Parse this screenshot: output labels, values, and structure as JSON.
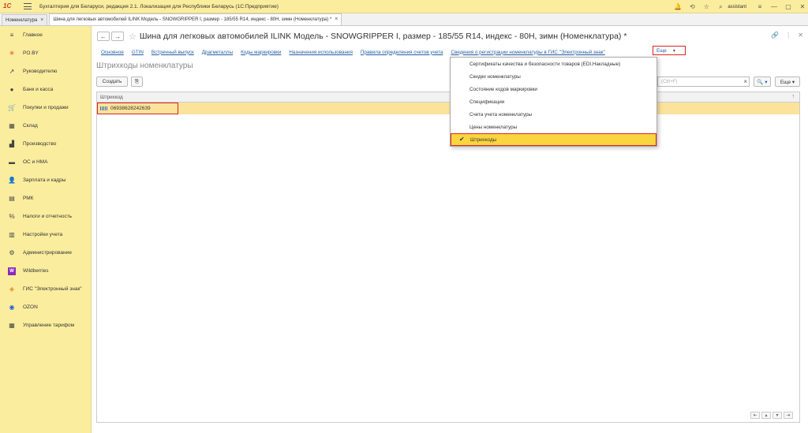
{
  "app": {
    "logo": "1С",
    "title": "Бухгалтерия для Беларуси, редакция 2.1. Локализация для Республики Беларусь   (1С:Предприятие)",
    "user": "assistant"
  },
  "tabs": [
    {
      "label": "Номенклатура",
      "close": "×"
    },
    {
      "label": "Шина для легковых автомобилей ILINK  Модель - SNOWGRIPPER I, размер - 185/55 R14, индекс - 80H, зимн (Номенклатура) *",
      "close": "×"
    }
  ],
  "sidebar": {
    "items": [
      {
        "label": "Главное",
        "icon": "≡"
      },
      {
        "label": "PO.BY",
        "icon": "✳"
      },
      {
        "label": "Руководителю",
        "icon": "↗"
      },
      {
        "label": "Банк и касса",
        "icon": "●"
      },
      {
        "label": "Покупки и продажи",
        "icon": "🛒"
      },
      {
        "label": "Склад",
        "icon": "▦"
      },
      {
        "label": "Производство",
        "icon": "▟"
      },
      {
        "label": "ОС и НМА",
        "icon": "▬"
      },
      {
        "label": "Зарплата и кадры",
        "icon": "👤"
      },
      {
        "label": "РМК",
        "icon": "▤"
      },
      {
        "label": "Налоги и отчетность",
        "icon": "%"
      },
      {
        "label": "Настройки учета",
        "icon": "▥"
      },
      {
        "label": "Администрирование",
        "icon": "⚙"
      },
      {
        "label": "Wildberries",
        "icon": "W"
      },
      {
        "label": "ГИС \"Электронный знак\"",
        "icon": "◈"
      },
      {
        "label": "OZON",
        "icon": "◉"
      },
      {
        "label": "Управление тарифом",
        "icon": "▦"
      }
    ]
  },
  "form": {
    "title": "Шина для легковых автомобилей ILINK  Модель - SNOWGRIPPER I, размер - 185/55 R14, индекс - 80H, зимн (Номенклатура) *",
    "back": "←",
    "forward": "→",
    "star": "☆",
    "links": [
      "Основное",
      "GTIN",
      "Встречный выпуск",
      "Драгметаллы",
      "Коды маркировки",
      "Назначения использования",
      "Правила определения счетов учета",
      "Сведения о регистрации номенклатуры в ГИС \"Электронный знак\""
    ],
    "more_label": "Еще",
    "more_arrow": "▾",
    "section_title": "Штрихкоды номенклатуры",
    "create_label": "Создать",
    "search_placeholder": "(Ctrl+F)",
    "search_clear": "×",
    "search_btn": "🔍 ▾",
    "more2_label": "Еще ▾",
    "column_header": "Штрихкод",
    "sort_arrow": "↑",
    "rows": [
      {
        "barcode": "06938628242639"
      }
    ]
  },
  "dropdown": {
    "items": [
      {
        "label": "Сертификаты качества и безопасности товаров (EDI.Накладные)"
      },
      {
        "label": "Скидки номенклатуры"
      },
      {
        "label": "Состояние кодов маркировки"
      },
      {
        "label": "Спецификации"
      },
      {
        "label": "Счета учета номенклатуры"
      },
      {
        "label": "Цены номенклатуры"
      },
      {
        "label": "Штрихкоды",
        "check": "✔"
      }
    ]
  },
  "colors": {
    "sidebar_bg": "#fbed9e",
    "selected_row": "#fbe39c",
    "dropdown_selected": "#f9d63f",
    "highlight_border": "#dd2222",
    "link": "#255fa3"
  }
}
